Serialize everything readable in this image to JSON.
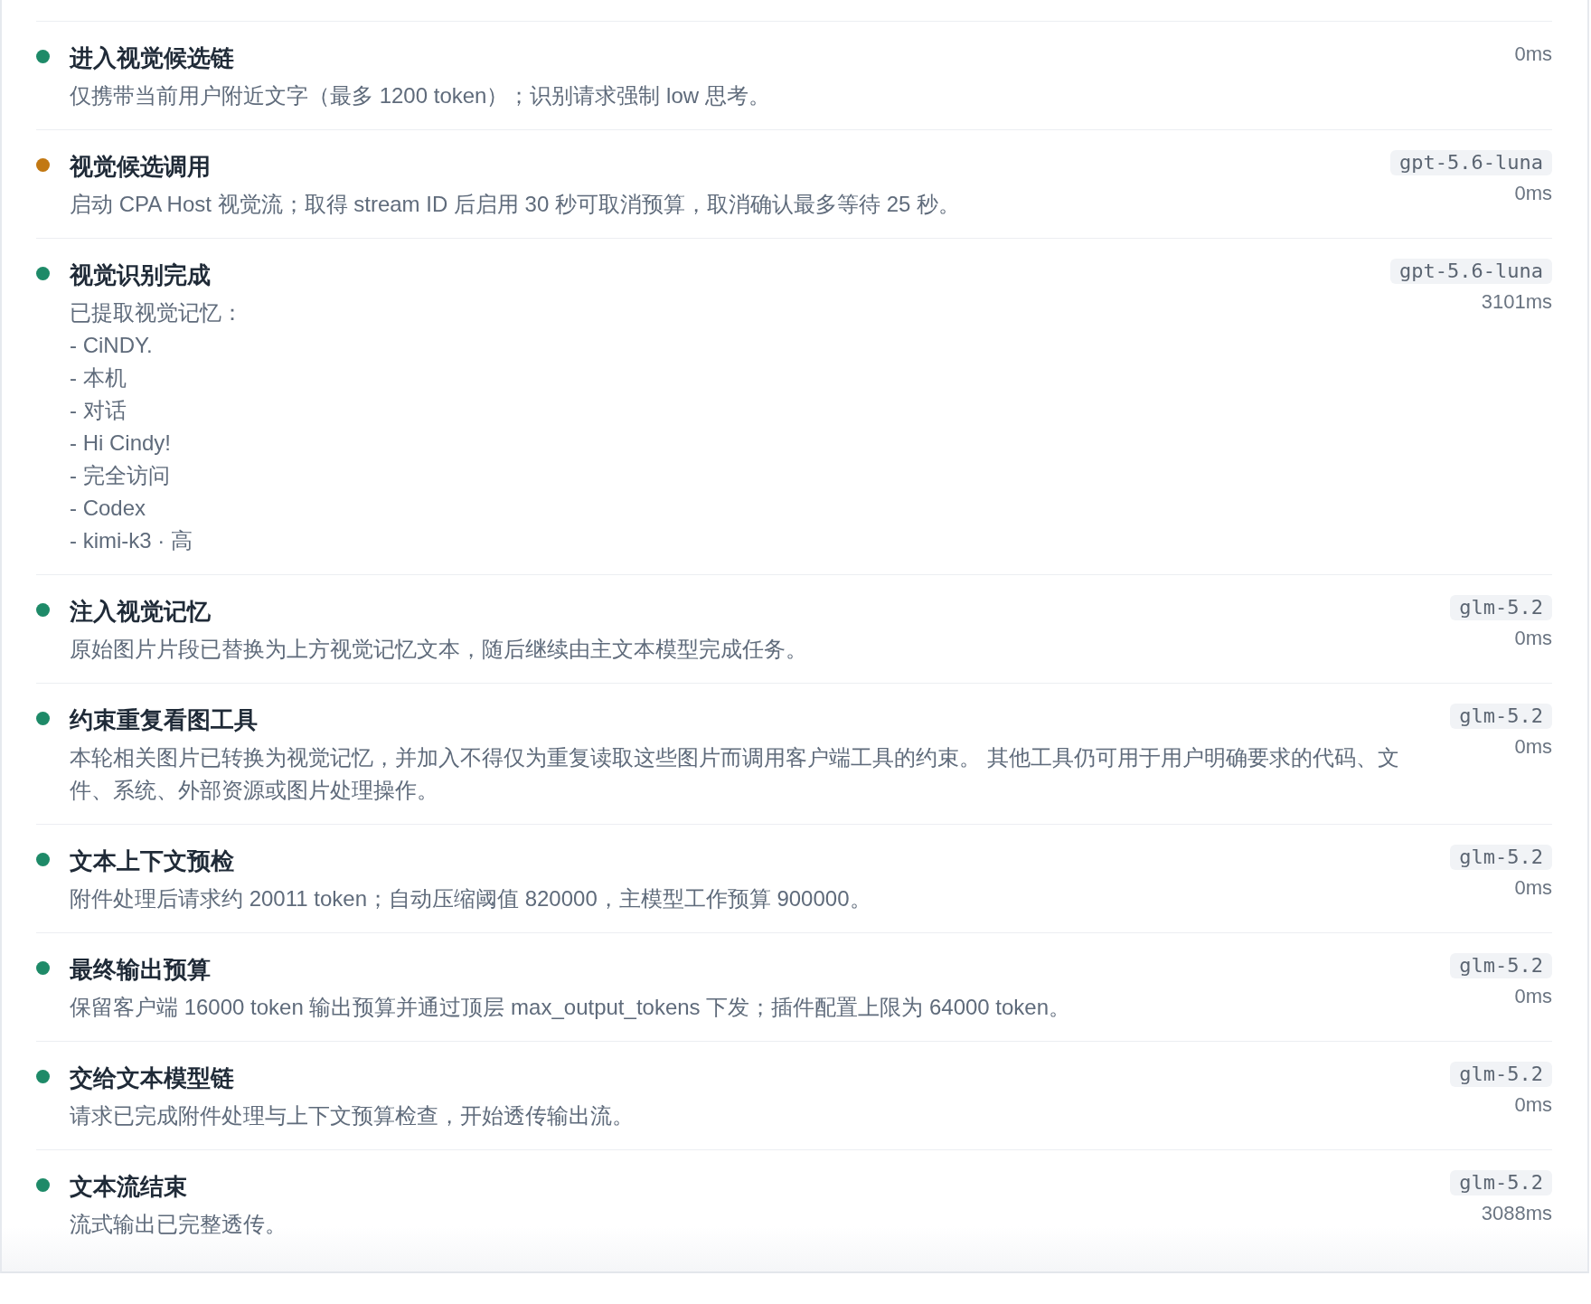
{
  "steps": [
    {
      "title": "进入视觉候选链",
      "description": "仅携带当前用户附近文字（最多 1200 token）；识别请求强制 low 思考。",
      "color": "#1e8a68",
      "duration": "0ms"
    },
    {
      "title": "视觉候选调用",
      "description": "启动 CPA Host 视觉流；取得 stream ID 后启用 30 秒可取消预算，取消确认最多等待 25 秒。",
      "color": "#c27812",
      "model": "gpt-5.6-luna",
      "duration": "0ms"
    },
    {
      "title": "视觉识别完成",
      "description": "已提取视觉记忆：\n- CiNDY.\n- 本机\n- 对话\n- Hi Cindy!\n- 完全访问\n- Codex\n- kimi-k3 · 高",
      "color": "#1e8a68",
      "model": "gpt-5.6-luna",
      "duration": "3101ms"
    },
    {
      "title": "注入视觉记忆",
      "description": "原始图片片段已替换为上方视觉记忆文本，随后继续由主文本模型完成任务。",
      "color": "#1e8a68",
      "model": "glm-5.2",
      "duration": "0ms"
    },
    {
      "title": "约束重复看图工具",
      "description": "本轮相关图片已转换为视觉记忆，并加入不得仅为重复读取这些图片而调用客户端工具的约束。 其他工具仍可用于用户明确要求的代码、文件、系统、外部资源或图片处理操作。",
      "color": "#1e8a68",
      "model": "glm-5.2",
      "duration": "0ms"
    },
    {
      "title": "文本上下文预检",
      "description": "附件处理后请求约 20011 token；自动压缩阈值 820000，主模型工作预算 900000。",
      "color": "#1e8a68",
      "model": "glm-5.2",
      "duration": "0ms"
    },
    {
      "title": "最终输出预算",
      "description": "保留客户端 16000 token 输出预算并通过顶层 max_output_tokens 下发；插件配置上限为 64000 token。",
      "color": "#1e8a68",
      "model": "glm-5.2",
      "duration": "0ms"
    },
    {
      "title": "交给文本模型链",
      "description": "请求已完成附件处理与上下文预算检查，开始透传输出流。",
      "color": "#1e8a68",
      "model": "glm-5.2",
      "duration": "0ms"
    },
    {
      "title": "文本流结束",
      "description": "流式输出已完整透传。",
      "color": "#1e8a68",
      "model": "glm-5.2",
      "duration": "3088ms"
    }
  ]
}
